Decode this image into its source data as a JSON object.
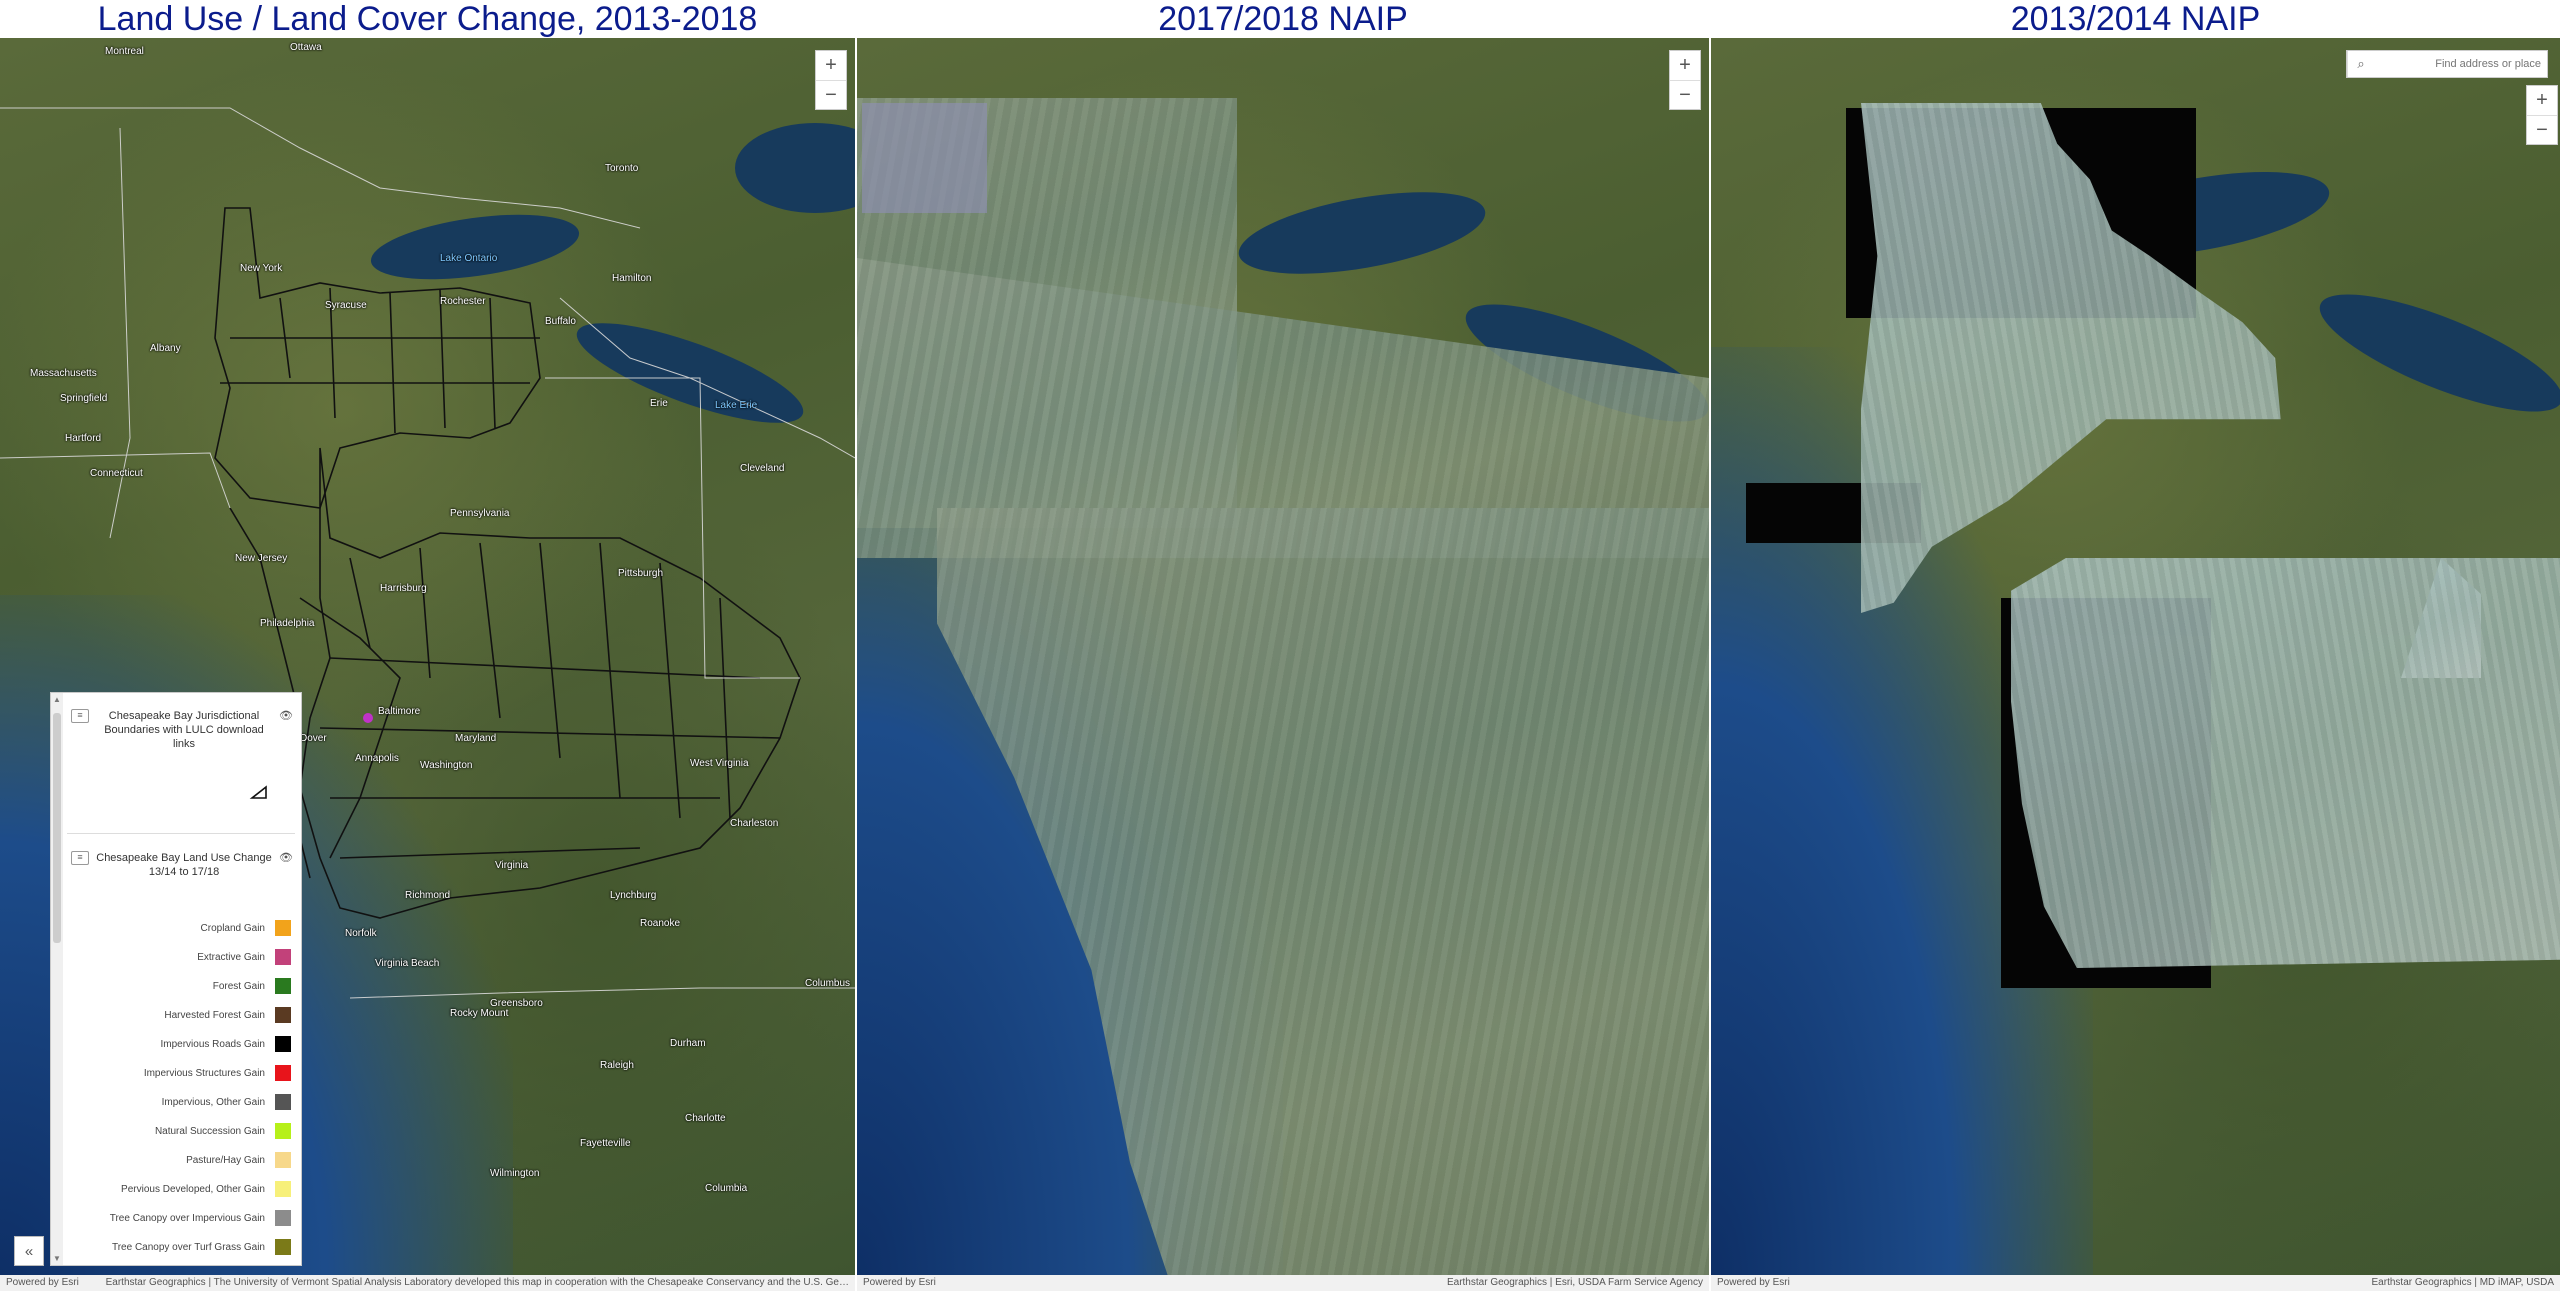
{
  "panels": [
    {
      "title": "Land Use / Land Cover Change, 2013-2018"
    },
    {
      "title": "2017/2018 NAIP"
    },
    {
      "title": "2013/2014 NAIP"
    }
  ],
  "zoom": {
    "in": "+",
    "out": "−"
  },
  "search": {
    "placeholder": "Find address or place",
    "icon": "search-icon"
  },
  "attribution": {
    "p1_left": "Powered by Esri",
    "p1_right": "Earthstar Geographics | The University of Vermont Spatial Analysis Laboratory developed this map in cooperation with the Chesapeake Conservancy and the U.S. Ge…",
    "p2_left": "Powered by Esri",
    "p2_right": "Earthstar Geographics | Esri, USDA Farm Service Agency",
    "p3_left": "Powered by Esri",
    "p3_right": "Earthstar Geographics | MD iMAP, USDA"
  },
  "legend": {
    "layer1_title": "Chesapeake Bay Jurisdictional Boundaries with LULC download links",
    "layer2_title": "Chesapeake Bay Land Use Change 13/14 to 17/18",
    "items": [
      {
        "label": "Cropland Gain",
        "color": "#f2a31b"
      },
      {
        "label": "Extractive Gain",
        "color": "#c2417a"
      },
      {
        "label": "Forest Gain",
        "color": "#2a7a1f"
      },
      {
        "label": "Harvested Forest Gain",
        "color": "#5a3a22"
      },
      {
        "label": "Impervious Roads Gain",
        "color": "#000000"
      },
      {
        "label": "Impervious Structures Gain",
        "color": "#e8141b"
      },
      {
        "label": "Impervious, Other Gain",
        "color": "#555555"
      },
      {
        "label": "Natural Succession Gain",
        "color": "#b6f01a"
      },
      {
        "label": "Pasture/Hay Gain",
        "color": "#f7d88a"
      },
      {
        "label": "Pervious Developed, Other Gain",
        "color": "#f7f07a"
      },
      {
        "label": "Tree Canopy over Impervious Gain",
        "color": "#8c8c8c"
      },
      {
        "label": "Tree Canopy over Turf Grass Gain",
        "color": "#7b7a18"
      }
    ]
  },
  "map_labels": [
    "Ottawa",
    "Montreal",
    "Toronto",
    "Hamilton",
    "Buffalo",
    "Rochester",
    "Syracuse",
    "Albany",
    "Erie",
    "Cleveland",
    "Pittsburgh",
    "Pennsylvania",
    "Harrisburg",
    "Philadelphia",
    "New Jersey",
    "Baltimore",
    "Washington",
    "Annapolis",
    "Richmond",
    "Virginia",
    "Virginia Beach",
    "Norfolk",
    "Raleigh",
    "Durham",
    "Charlotte",
    "West Virginia",
    "Charleston",
    "Lake Erie",
    "Lake Ontario",
    "New York",
    "Hartford",
    "Massachusetts",
    "Connecticut",
    "Springfield",
    "Maryland",
    "Dover",
    "Lynchburg",
    "Roanoke",
    "Greensboro",
    "Fayetteville",
    "Columbia",
    "Wilmington",
    "Rocky Mount",
    "Columbus"
  ]
}
